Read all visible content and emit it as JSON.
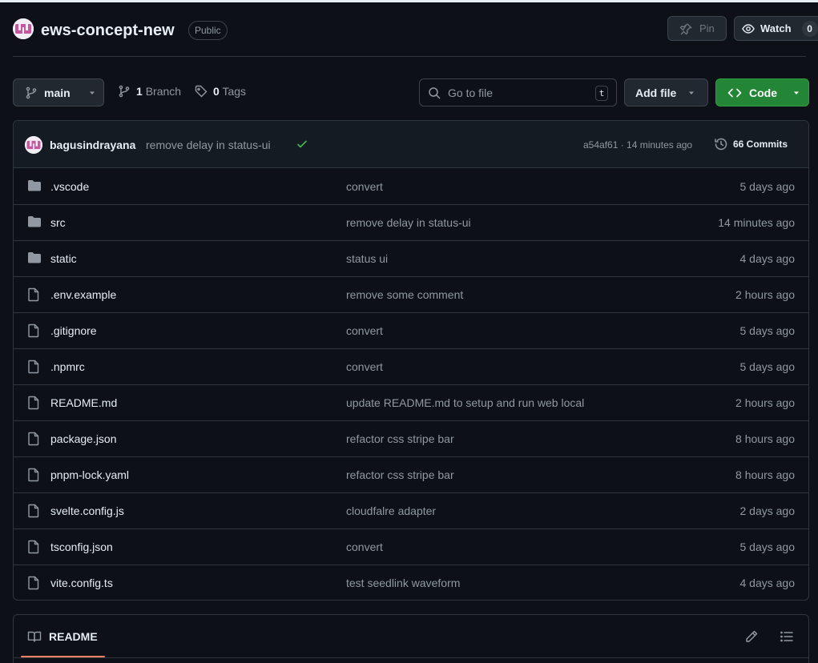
{
  "repo": {
    "name": "ews-concept-new",
    "visibility": "Public",
    "pin_label": "Pin",
    "watch_label": "Watch",
    "watch_count": "0"
  },
  "toolbar": {
    "branch": "main",
    "branch_count": "1",
    "branch_label": "Branch",
    "tag_count": "0",
    "tag_label": "Tags",
    "search_placeholder": "Go to file",
    "search_shortcut": "t",
    "add_file_label": "Add file",
    "code_label": "Code"
  },
  "latest_commit": {
    "author": "bagusindrayana",
    "message": "remove delay in status-ui",
    "sha_time": "a54af61 · 14 minutes ago",
    "commits_label": "66 Commits"
  },
  "files": [
    {
      "type": "dir",
      "name": ".vscode",
      "message": "convert",
      "time": "5 days ago"
    },
    {
      "type": "dir",
      "name": "src",
      "message": "remove delay in status-ui",
      "time": "14 minutes ago"
    },
    {
      "type": "dir",
      "name": "static",
      "message": "status ui",
      "time": "4 days ago"
    },
    {
      "type": "file",
      "name": ".env.example",
      "message": "remove some comment",
      "time": "2 hours ago"
    },
    {
      "type": "file",
      "name": ".gitignore",
      "message": "convert",
      "time": "5 days ago"
    },
    {
      "type": "file",
      "name": ".npmrc",
      "message": "convert",
      "time": "5 days ago"
    },
    {
      "type": "file",
      "name": "README.md",
      "message": "update README.md to setup and run web local",
      "time": "2 hours ago"
    },
    {
      "type": "file",
      "name": "package.json",
      "message": "refactor css stripe bar",
      "time": "8 hours ago"
    },
    {
      "type": "file",
      "name": "pnpm-lock.yaml",
      "message": "refactor css stripe bar",
      "time": "8 hours ago"
    },
    {
      "type": "file",
      "name": "svelte.config.js",
      "message": "cloudfalre adapter",
      "time": "2 days ago"
    },
    {
      "type": "file",
      "name": "tsconfig.json",
      "message": "convert",
      "time": "5 days ago"
    },
    {
      "type": "file",
      "name": "vite.config.ts",
      "message": "test seedlink waveform",
      "time": "4 days ago"
    }
  ],
  "readme": {
    "tab_label": "README"
  },
  "colors": {
    "background": "#0d1117",
    "border": "#30363d",
    "muted_text": "#9198a1",
    "code_button": "#238636",
    "success": "#3fb950",
    "tab_underline": "#f78166",
    "folder_icon": "#9198a1"
  },
  "icons": {
    "directory": "folder-icon",
    "file": "file-icon"
  }
}
